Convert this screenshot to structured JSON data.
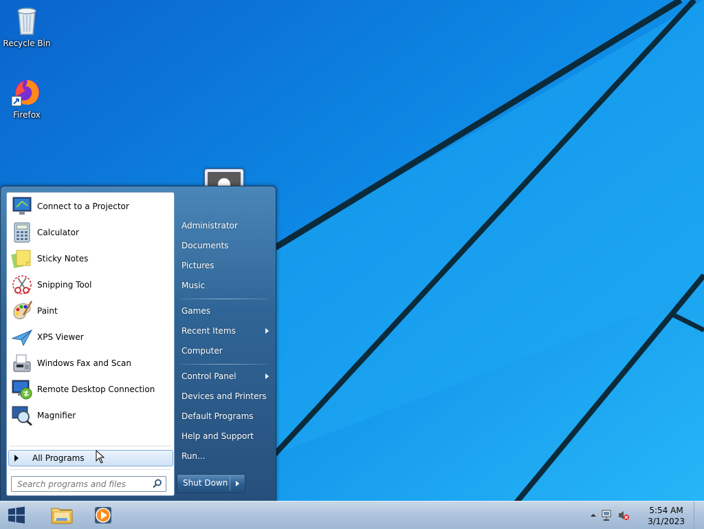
{
  "desktop": {
    "icons": [
      {
        "label": "Recycle Bin",
        "icon": "recycle-bin-icon"
      },
      {
        "label": "Firefox",
        "icon": "firefox-icon"
      }
    ]
  },
  "start_menu": {
    "programs": [
      {
        "label": "Connect to a Projector",
        "icon": "projector-icon"
      },
      {
        "label": "Calculator",
        "icon": "calculator-icon"
      },
      {
        "label": "Sticky Notes",
        "icon": "sticky-notes-icon"
      },
      {
        "label": "Snipping Tool",
        "icon": "scissors-icon"
      },
      {
        "label": "Paint",
        "icon": "paint-palette-icon"
      },
      {
        "label": "XPS Viewer",
        "icon": "paper-plane-icon"
      },
      {
        "label": "Windows Fax and Scan",
        "icon": "fax-icon"
      },
      {
        "label": "Remote Desktop Connection",
        "icon": "remote-desktop-icon"
      },
      {
        "label": "Magnifier",
        "icon": "magnifier-icon"
      }
    ],
    "all_programs_label": "All Programs",
    "search_placeholder": "Search programs and files",
    "right_links": [
      {
        "label": "Administrator",
        "submenu": false
      },
      {
        "label": "Documents",
        "submenu": false
      },
      {
        "label": "Pictures",
        "submenu": false
      },
      {
        "label": "Music",
        "submenu": false
      },
      {
        "label": "Games",
        "submenu": false
      },
      {
        "label": "Recent Items",
        "submenu": true
      },
      {
        "label": "Computer",
        "submenu": false
      },
      {
        "label": "Control Panel",
        "submenu": true
      },
      {
        "label": "Devices and Printers",
        "submenu": false
      },
      {
        "label": "Default Programs",
        "submenu": false
      },
      {
        "label": "Help and Support",
        "submenu": false
      },
      {
        "label": "Run...",
        "submenu": false
      }
    ],
    "shutdown_label": "Shut Down"
  },
  "taskbar": {
    "apps": [
      {
        "icon": "file-explorer-icon"
      },
      {
        "icon": "media-player-icon"
      }
    ],
    "clock": {
      "time": "5:54 AM",
      "date": "3/1/2023"
    }
  },
  "colors": {
    "wallpaper": "#0b84e6",
    "menu_dark": "#274f7c",
    "taskbar": "#aec4dd"
  }
}
